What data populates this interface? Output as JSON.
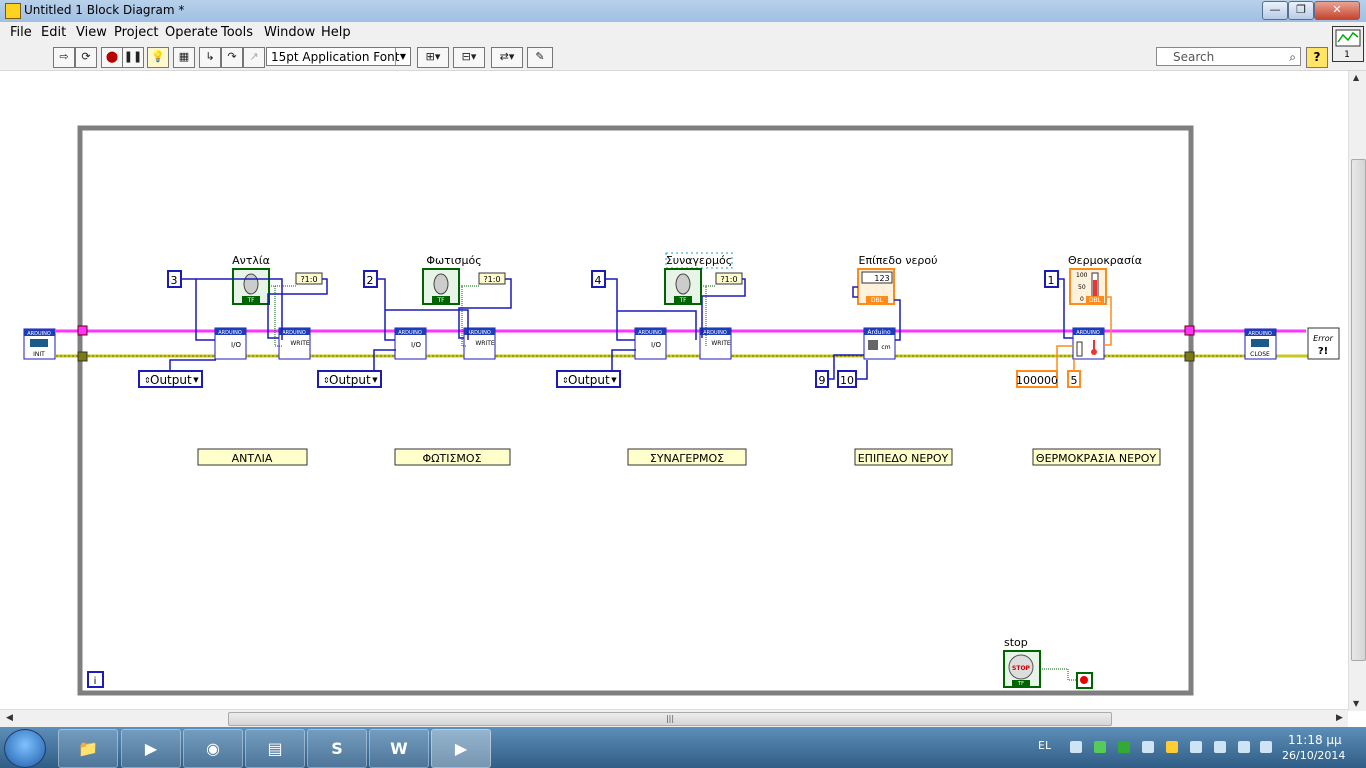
{
  "window": {
    "title": "Untitled 1 Block Diagram *"
  },
  "menu": [
    "File",
    "Edit",
    "View",
    "Project",
    "Operate",
    "Tools",
    "Window",
    "Help"
  ],
  "toolbar": {
    "font": "15pt Application Font",
    "search_placeholder": "Search",
    "help": "?"
  },
  "diagram": {
    "constants": {
      "pump_pin": "3",
      "light_pin": "2",
      "alarm_pin": "4",
      "level_pin_a": "9",
      "level_pin_b": "10",
      "temp_pin": "1",
      "temp_const_a": "100000",
      "temp_const_b": "5"
    },
    "enums": {
      "output": "Output"
    },
    "controls": {
      "pump": "Αντλία",
      "light": "Φωτισμός",
      "alarm": "Συναγερμός",
      "stop": "stop"
    },
    "indicators": {
      "level": "Επίπεδο νερού",
      "temperature": "Θερμοκρασία"
    },
    "labels": {
      "pump": "ΑΝΤΛΙΑ",
      "light": "ΦΩΤΙΣΜΟΣ",
      "alarm": "ΣΥΝΑΓΕΡΜΟΣ",
      "level": "ΕΠΙΠΕΔΟ ΝΕΡΟΥ",
      "temperature": "ΘΕΡΜΟΚΡΑΣΙΑ ΝΕΡΟΥ"
    },
    "vi": {
      "header": "ARDUINO",
      "init": "INIT",
      "close": "CLOSE",
      "io": "I/O",
      "write": "WRITE",
      "cm": "cm",
      "bool_display": "?1:0",
      "tf": "TF",
      "dbl": "DBL",
      "stop_btn": "STOP",
      "error": "Error",
      "num": "123",
      "loop_info": "i"
    },
    "thermo_scale": {
      "top": "100",
      "mid": "50",
      "bottom": "0"
    }
  },
  "taskbar": {
    "language": "EL",
    "time": "11:18 μμ",
    "date": "26/10/2014"
  },
  "colors": {
    "bool_wire": "#006400",
    "int_wire": "#1c1cb8",
    "error_wire": "#c8c820",
    "ref_wire": "#ff33ff",
    "dbl_wire": "#ff8c1a"
  }
}
